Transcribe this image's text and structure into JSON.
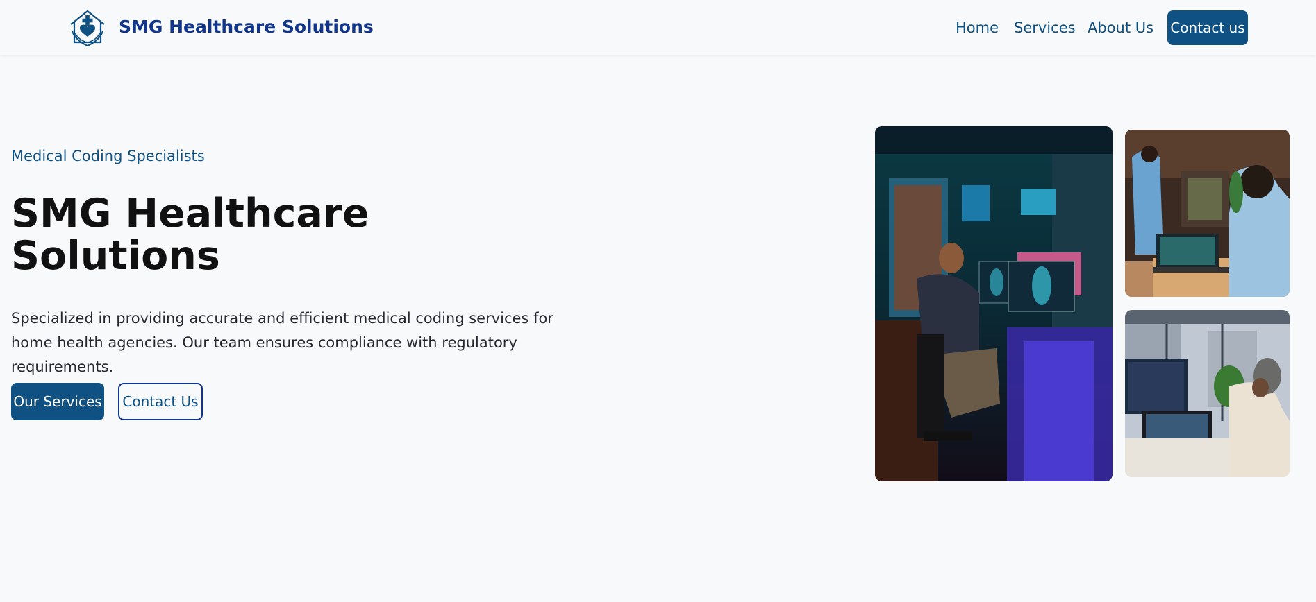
{
  "header": {
    "brand": "SMG Healthcare Solutions",
    "logo_icon": "house-heart-hands-icon",
    "nav": [
      {
        "label": "Home"
      },
      {
        "label": "Services"
      },
      {
        "label": "About Us"
      }
    ],
    "cta_label": "Contact us"
  },
  "hero": {
    "eyebrow": "Medical Coding Specialists",
    "title": "SMG Healthcare Solutions",
    "description": "Specialized in providing accurate and efficient medical coding services for home health agencies. Our team ensures compliance with regulatory requirements.",
    "primary_button": "Our Services",
    "secondary_button": "Contact Us"
  },
  "images": [
    {
      "name": "man-at-computer-photo"
    },
    {
      "name": "medical-team-laptop-photo"
    },
    {
      "name": "woman-office-screens-photo"
    }
  ],
  "colors": {
    "brand_navy": "#10358a",
    "accent_blue": "#0f5182",
    "background": "#f8f9fb",
    "heading": "#111111"
  }
}
